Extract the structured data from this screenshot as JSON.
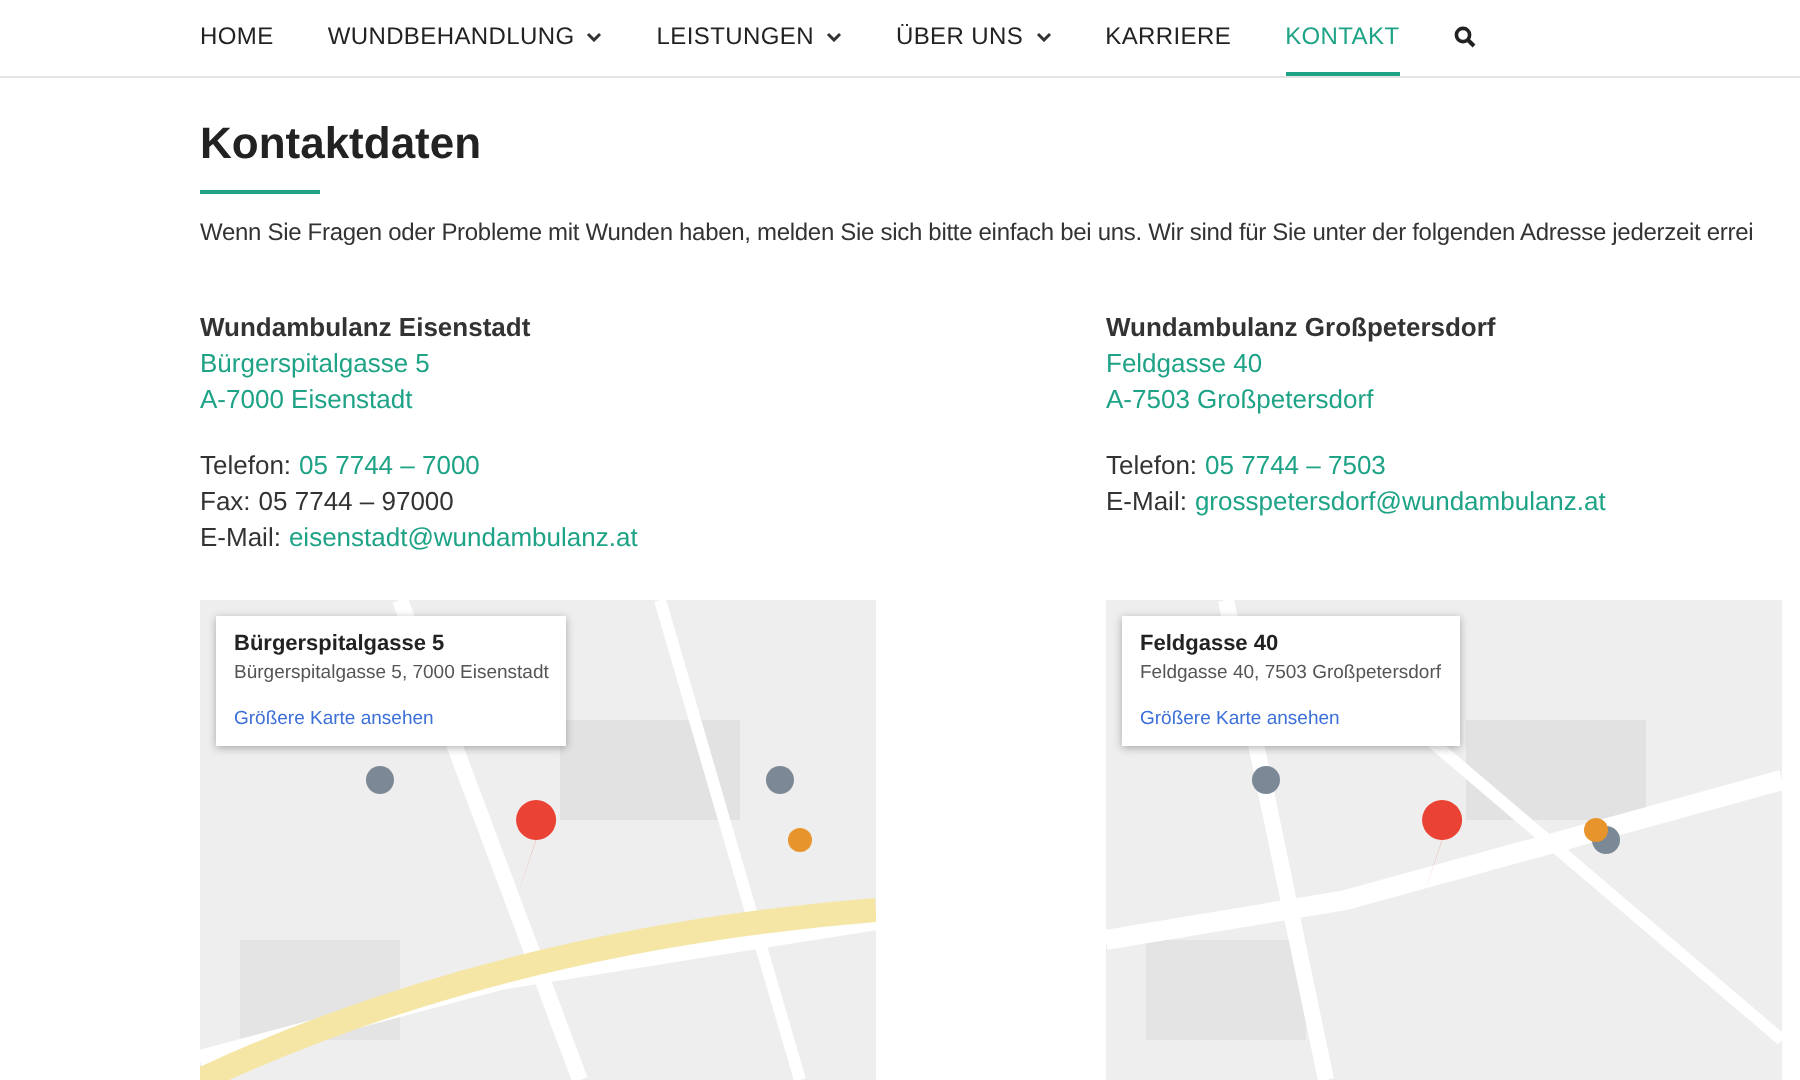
{
  "nav": {
    "items": [
      {
        "label": "HOME",
        "dropdown": false,
        "selected": false
      },
      {
        "label": "WUNDBEHANDLUNG",
        "dropdown": true,
        "selected": false
      },
      {
        "label": "LEISTUNGEN",
        "dropdown": true,
        "selected": false
      },
      {
        "label": "ÜBER UNS",
        "dropdown": true,
        "selected": false
      },
      {
        "label": "KARRIERE",
        "dropdown": false,
        "selected": false
      },
      {
        "label": "KONTAKT",
        "dropdown": false,
        "selected": true
      }
    ]
  },
  "title": "Kontaktdaten",
  "intro": "Wenn Sie Fragen oder Probleme mit Wunden haben, melden Sie sich bitte einfach bei uns. Wir sind für Sie unter der folgenden Adresse jederzeit errei",
  "locations": [
    {
      "name": "Wundambulanz Eisenstadt",
      "address_lines": [
        "Bürgerspitalgasse 5",
        "A-7000 Eisenstadt"
      ],
      "contacts": [
        {
          "label": "Telefon:",
          "value": "05 7744 – 7000",
          "link": true
        },
        {
          "label": "Fax:",
          "value": "05 7744 – 97000",
          "link": false
        },
        {
          "label": "E-Mail:",
          "value": "eisenstadt@wundambulanz.at",
          "link": true
        }
      ],
      "map": {
        "card_title": "Bürgerspitalgasse 5",
        "card_address": "Bürgerspitalgasse 5, 7000 Eisenstadt",
        "card_link": "Größere Karte ansehen"
      }
    },
    {
      "name": "Wundambulanz Großpetersdorf",
      "address_lines": [
        "Feldgasse 40",
        "A-7503 Großpetersdorf"
      ],
      "contacts": [
        {
          "label": "Telefon:",
          "value": "05 7744 – 7503",
          "link": true
        },
        {
          "label": "E-Mail:",
          "value": "grosspetersdorf@wundambulanz.at",
          "link": true
        }
      ],
      "map": {
        "card_title": "Feldgasse 40",
        "card_address": "Feldgasse 40, 7503 Großpetersdorf",
        "card_link": "Größere Karte ansehen"
      }
    }
  ]
}
